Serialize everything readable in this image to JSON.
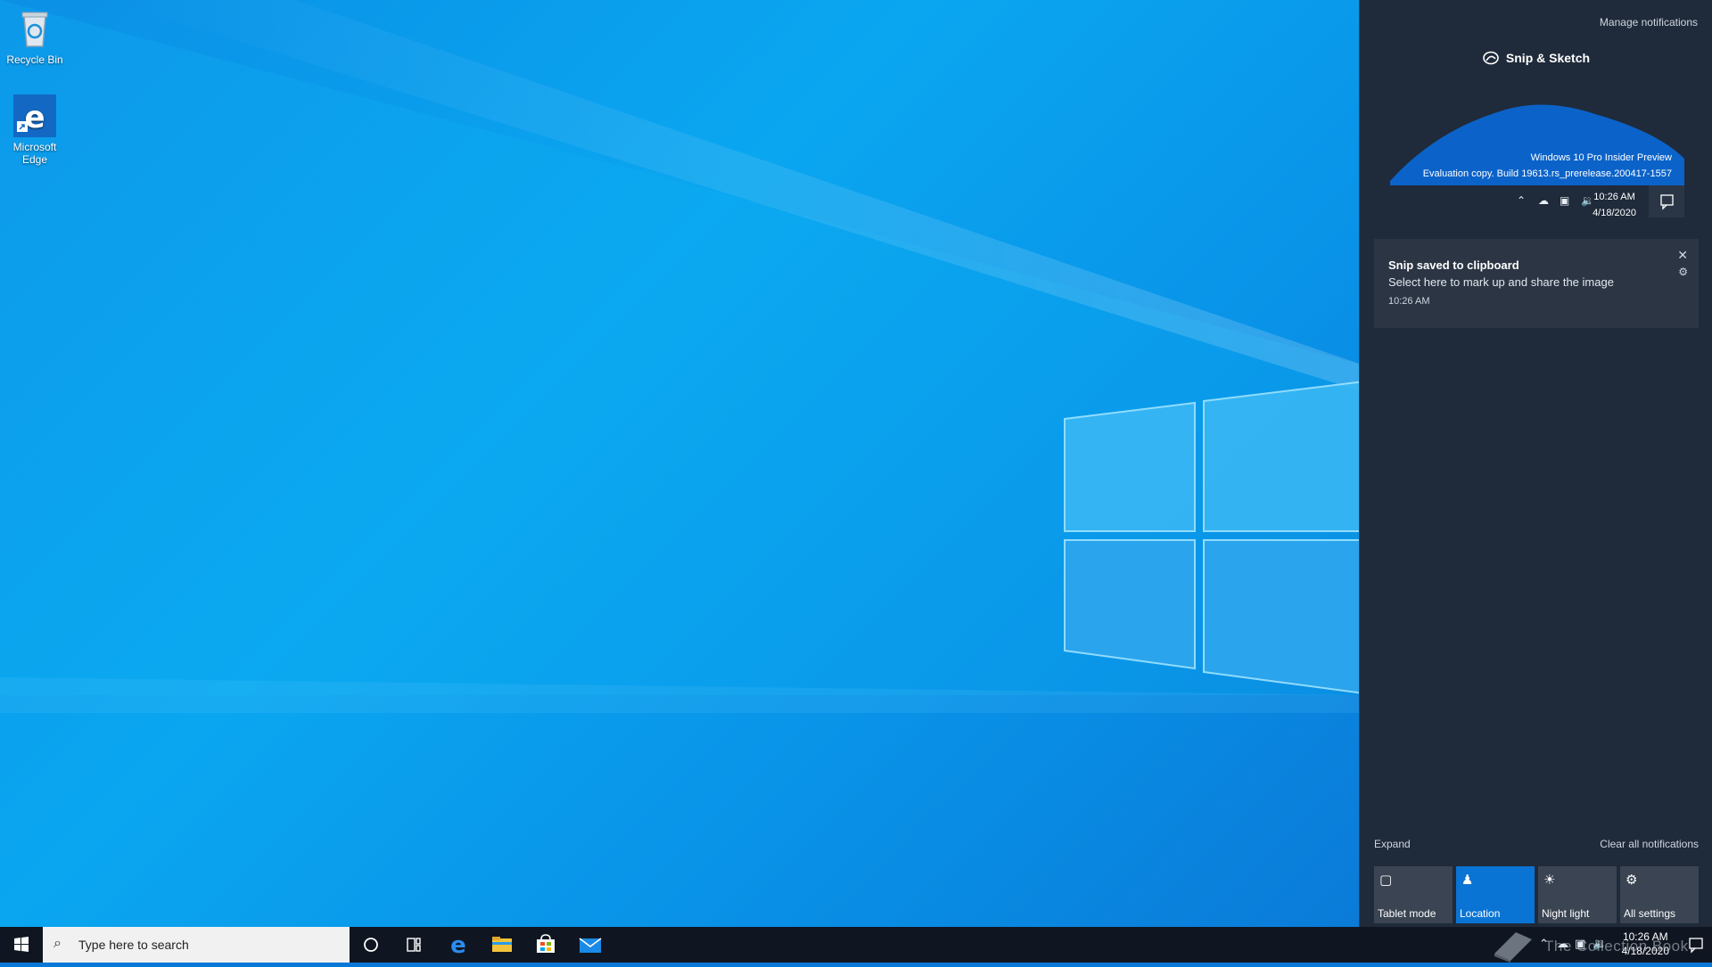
{
  "desktop": {
    "icons": [
      {
        "label": "Recycle Bin",
        "icon": "recycle-bin-icon"
      },
      {
        "label": "Microsoft Edge",
        "icon": "edge-icon"
      }
    ]
  },
  "action_center": {
    "manage_link": "Manage notifications",
    "app_name": "Snip & Sketch",
    "thumbnail": {
      "watermark_line1": "Windows 10 Pro Insider Preview",
      "watermark_line2": "Evaluation copy. Build 19613.rs_prerelease.200417-1557",
      "time": "10:26 AM",
      "date": "4/18/2020"
    },
    "notification": {
      "title": "Snip saved to clipboard",
      "body": "Select here to mark up and share the image",
      "time": "10:26 AM"
    },
    "expand_label": "Expand",
    "clear_label": "Clear all notifications",
    "quick_actions": [
      {
        "label": "Tablet mode",
        "icon": "tablet-mode-icon",
        "active": false
      },
      {
        "label": "Location",
        "icon": "location-icon",
        "active": true
      },
      {
        "label": "Night light",
        "icon": "night-light-icon",
        "active": false
      },
      {
        "label": "All settings",
        "icon": "settings-icon",
        "active": false
      }
    ]
  },
  "taskbar": {
    "search_placeholder": "Type here to search",
    "pinned": [
      "cortana-icon",
      "task-view-icon",
      "edge-icon",
      "file-explorer-icon",
      "store-icon",
      "mail-icon"
    ],
    "clock_time": "10:26 AM",
    "clock_date": "4/18/2020",
    "watermark": "The Collection Book"
  },
  "colors": {
    "accent": "#0a74d4",
    "action_center_bg": "#1f2a3a",
    "taskbar_bg": "#101621"
  }
}
